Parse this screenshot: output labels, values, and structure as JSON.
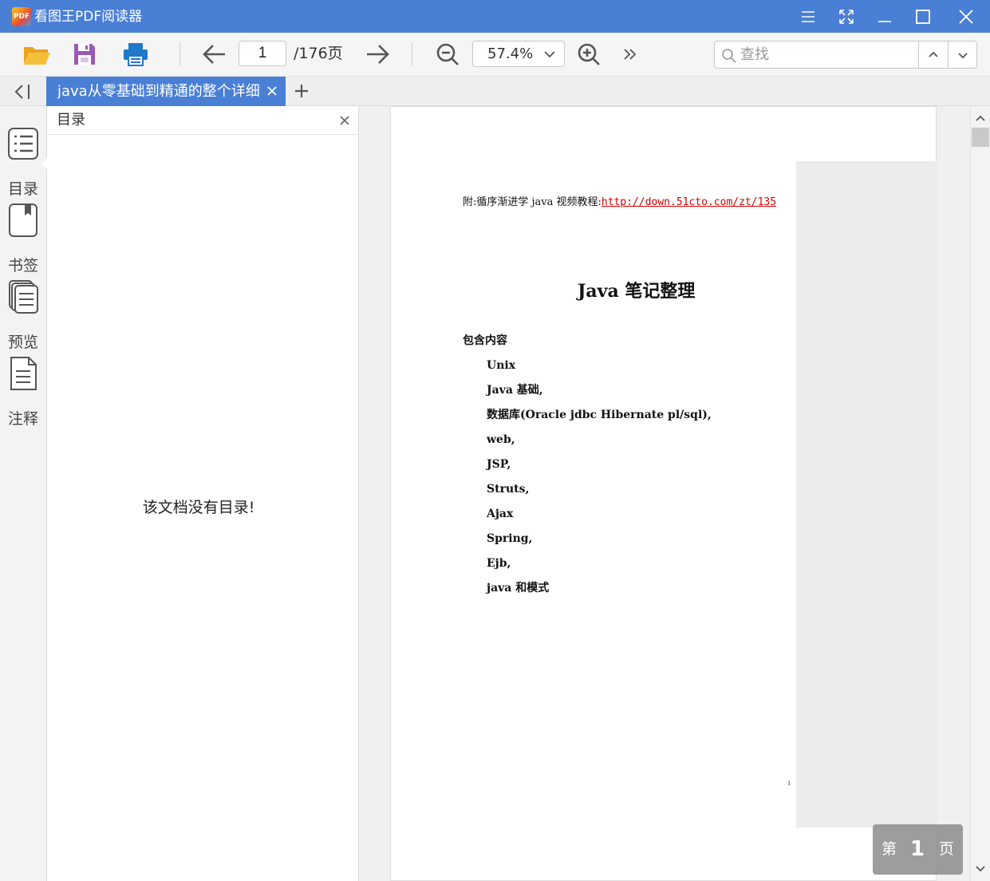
{
  "app": {
    "title": "看图王PDF阅读器",
    "logo_text": "PDF",
    "accent_color": "#4a7fd6"
  },
  "window_controls": [
    "menu-icon",
    "fullscreen-icon",
    "minimize-icon",
    "maximize-icon",
    "close-icon"
  ],
  "toolbar": {
    "icons": [
      "folder-open-icon",
      "save-icon",
      "print-icon",
      "arrow-left-icon",
      "arrow-right-icon",
      "zoom-out-icon",
      "zoom-in-icon",
      "more-icon"
    ],
    "page_current": "1",
    "page_total": "/176页",
    "zoom": "57.4%",
    "search_placeholder": "查找"
  },
  "tabs": {
    "active_tab": "java从零基础到精通的整个详细笔记",
    "add_icon": "plus-icon"
  },
  "sidebar": {
    "items": [
      {
        "label": "目录",
        "icon": "toc-list-icon"
      },
      {
        "label": "书签",
        "icon": "bookmark-icon"
      },
      {
        "label": "预览",
        "icon": "thumbnails-icon"
      },
      {
        "label": "注释",
        "icon": "annotation-icon"
      }
    ]
  },
  "toc_panel": {
    "title": "目录",
    "empty_message": "该文档没有目录!"
  },
  "document": {
    "ref_prefix": "附:循序渐进学 java 视频教程:",
    "ref_link": "http://down.51cto.com/zt/135",
    "heading": "Java  笔记整理",
    "intro": "包含内容",
    "items": [
      "Unix",
      "Java  基础,",
      "数据库(Oracle jdbc Hibernate pl/sql),",
      "web,",
      "JSP,",
      "Struts,",
      "Ajax",
      "Spring,",
      "Ejb,",
      "java 和模式"
    ],
    "footer_page_number": "1"
  },
  "page_badge": {
    "prefix": "第",
    "number": "1",
    "suffix": "页"
  }
}
